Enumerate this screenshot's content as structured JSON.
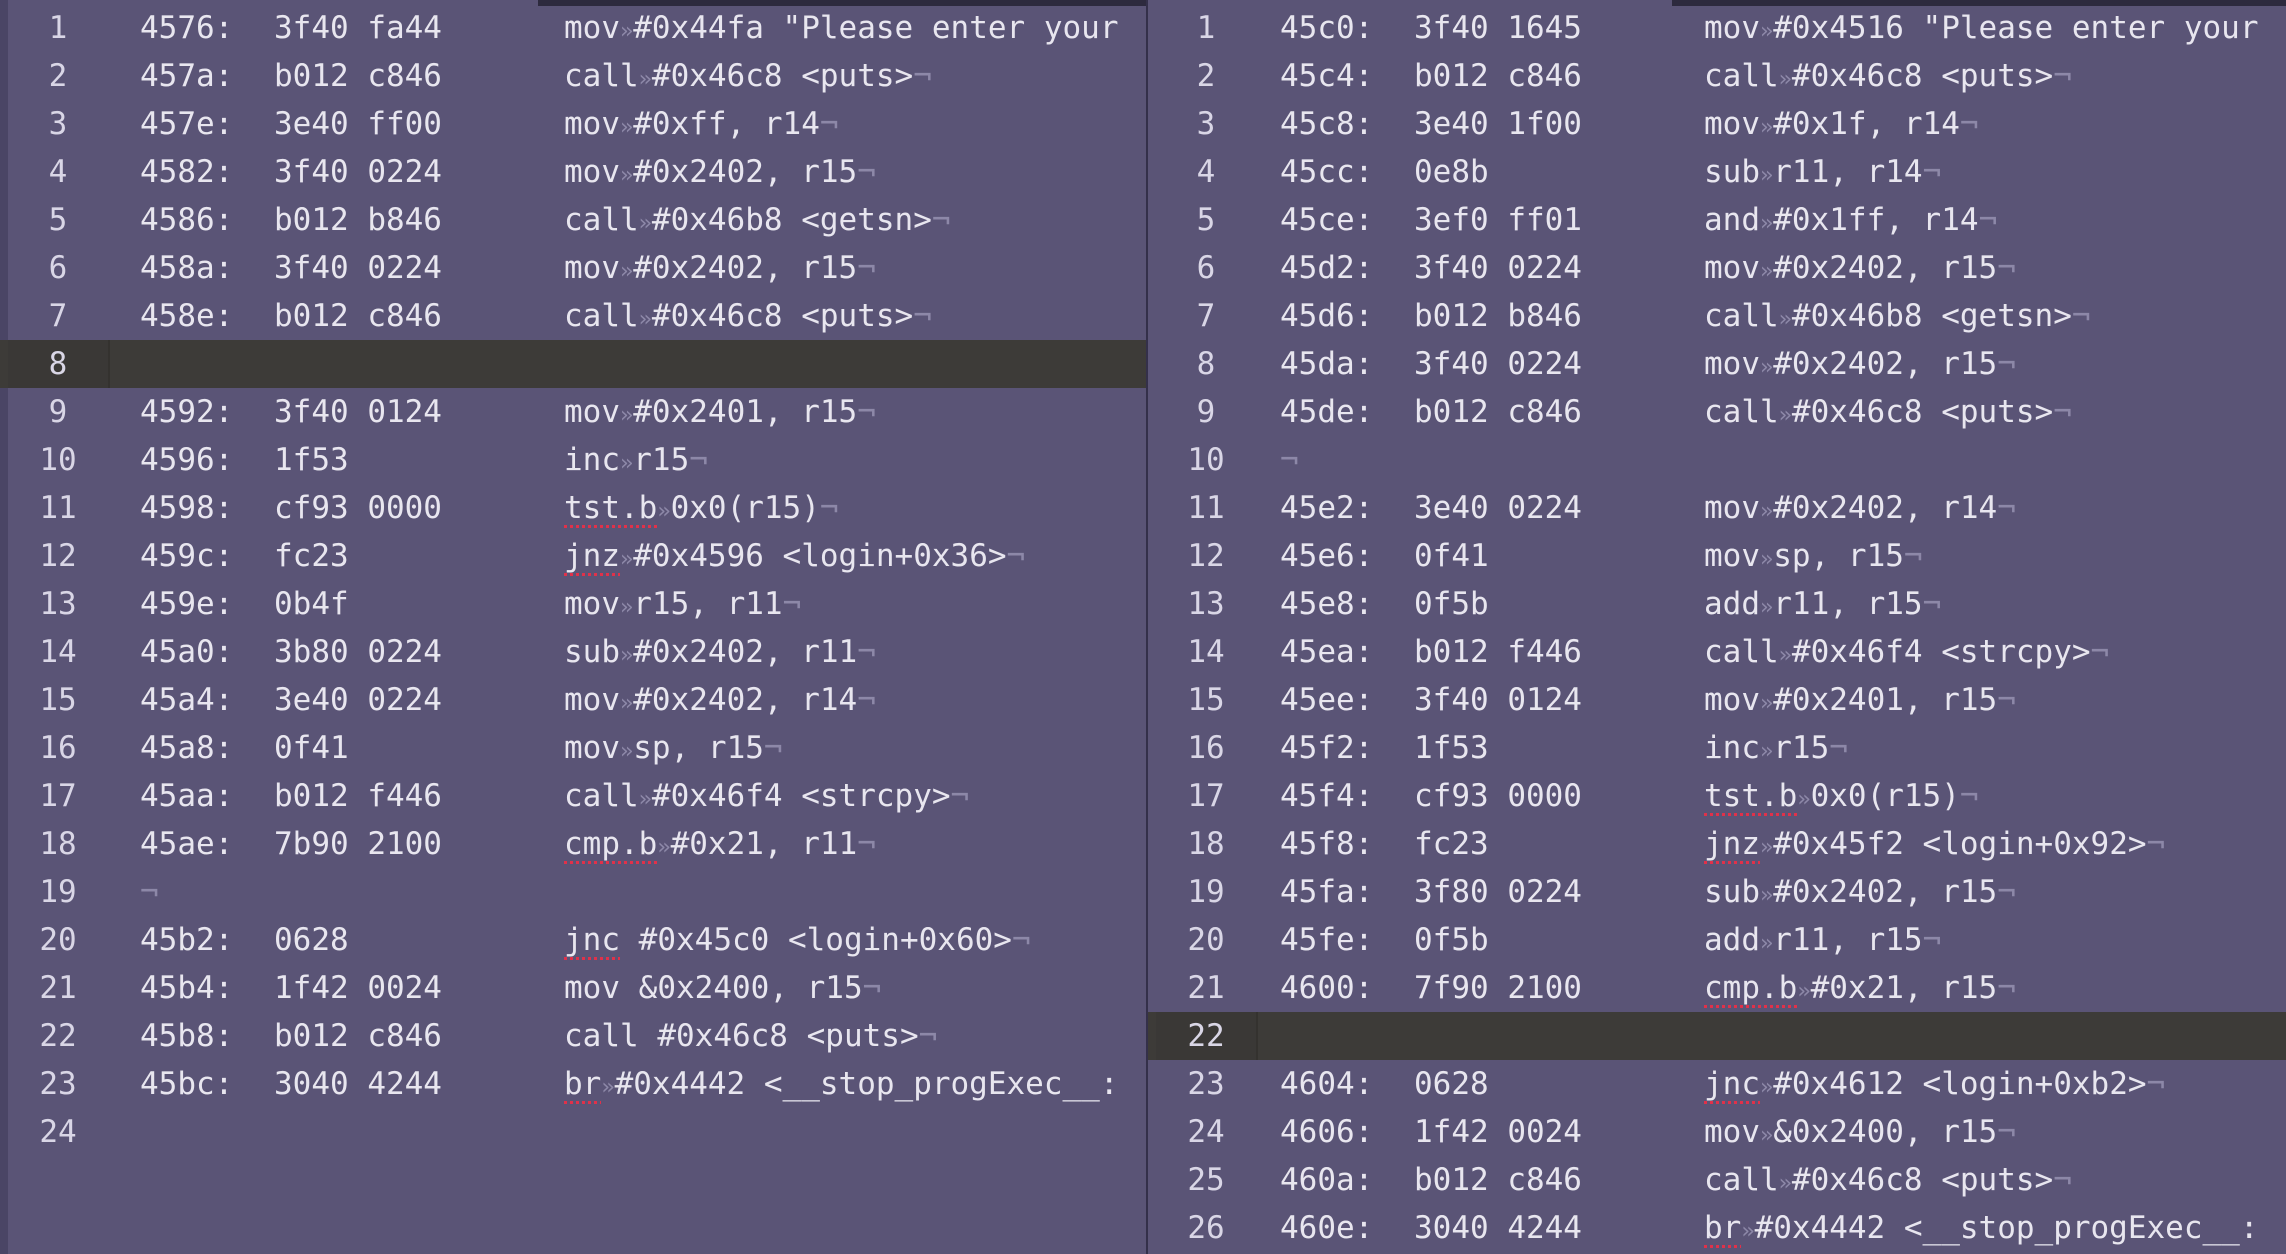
{
  "colors": {
    "background": "#5a5476",
    "current_line": "#3d3b38",
    "text": "#e8e6ef",
    "invisible_chars": "#8d88a8",
    "spell_underline": "#e0314a"
  },
  "icons": {
    "line_end": "pilcrow-icon",
    "tab_mark": "tab-arrow-icon"
  },
  "left_pane": {
    "lines": [
      {
        "num": "1",
        "addr": "4576:",
        "bytes": "3f40 fa44",
        "op": "mov",
        "sep": "tab",
        "args": "#0x44fa \"Please enter your"
      },
      {
        "num": "2",
        "addr": "457a:",
        "bytes": "b012 c846",
        "op": "call",
        "sep": "tab",
        "args": "#0x46c8 <puts>"
      },
      {
        "num": "3",
        "addr": "457e:",
        "bytes": "3e40 ff00",
        "op": "mov",
        "sep": "tab",
        "args": "#0xff, r14"
      },
      {
        "num": "4",
        "addr": "4582:",
        "bytes": "3f40 0224",
        "op": "mov",
        "sep": "tab",
        "args": "#0x2402, r15"
      },
      {
        "num": "5",
        "addr": "4586:",
        "bytes": "b012 b846",
        "op": "call",
        "sep": "tab",
        "args": "#0x46b8 <getsn>"
      },
      {
        "num": "6",
        "addr": "458a:",
        "bytes": "3f40 0224",
        "op": "mov",
        "sep": "tab",
        "args": "#0x2402, r15"
      },
      {
        "num": "7",
        "addr": "458e:",
        "bytes": "b012 c846",
        "op": "call",
        "sep": "tab",
        "args": "#0x46c8 <puts>"
      },
      {
        "num": "8",
        "addr": "",
        "bytes": "",
        "op": "",
        "sep": "",
        "args": ""
      },
      {
        "num": "9",
        "addr": "4592:",
        "bytes": "3f40 0124",
        "op": "mov",
        "sep": "tab",
        "args": "#0x2401, r15"
      },
      {
        "num": "10",
        "addr": "4596:",
        "bytes": "1f53",
        "op": "inc",
        "sep": "tab",
        "args": "r15"
      },
      {
        "num": "11",
        "addr": "4598:",
        "bytes": "cf93 0000",
        "op": "tst.b",
        "sep": "tab",
        "args": "0x0(r15)"
      },
      {
        "num": "12",
        "addr": "459c:",
        "bytes": "fc23",
        "op": "jnz",
        "sep": "tab",
        "args": "#0x4596 <login+0x36>"
      },
      {
        "num": "13",
        "addr": "459e:",
        "bytes": "0b4f",
        "op": "mov",
        "sep": "tab",
        "args": "r15, r11"
      },
      {
        "num": "14",
        "addr": "45a0:",
        "bytes": "3b80 0224",
        "op": "sub",
        "sep": "tab",
        "args": "#0x2402, r11"
      },
      {
        "num": "15",
        "addr": "45a4:",
        "bytes": "3e40 0224",
        "op": "mov",
        "sep": "tab",
        "args": "#0x2402, r14"
      },
      {
        "num": "16",
        "addr": "45a8:",
        "bytes": "0f41",
        "op": "mov",
        "sep": "tab",
        "args": "sp, r15"
      },
      {
        "num": "17",
        "addr": "45aa:",
        "bytes": "b012 f446",
        "op": "call",
        "sep": "tab",
        "args": "#0x46f4 <strcpy>"
      },
      {
        "num": "18",
        "addr": "45ae:",
        "bytes": "7b90 2100",
        "op": "cmp.b",
        "sep": "tab",
        "args": "#0x21, r11"
      },
      {
        "num": "19",
        "addr": "",
        "bytes": "",
        "op": "",
        "sep": "",
        "args": ""
      },
      {
        "num": "20",
        "addr": "45b2:",
        "bytes": "0628",
        "op": "jnc",
        "sep": "space",
        "args": "#0x45c0 <login+0x60>"
      },
      {
        "num": "21",
        "addr": "45b4:",
        "bytes": "1f42 0024",
        "op": "mov",
        "sep": "space",
        "args": "&0x2400, r15"
      },
      {
        "num": "22",
        "addr": "45b8:",
        "bytes": "b012 c846",
        "op": "call",
        "sep": "space",
        "args": "#0x46c8 <puts>"
      },
      {
        "num": "23",
        "addr": "45bc:",
        "bytes": "3040 4244",
        "op": "br",
        "sep": "tab",
        "args": "#0x4442 <__stop_progExec__:"
      },
      {
        "num": "24",
        "addr": "",
        "bytes": "",
        "op": "",
        "sep": "",
        "args": ""
      }
    ]
  },
  "right_pane": {
    "lines": [
      {
        "num": "1",
        "addr": "45c0:",
        "bytes": "3f40 1645",
        "op": "mov",
        "sep": "tab",
        "args": "#0x4516 \"Please enter your"
      },
      {
        "num": "2",
        "addr": "45c4:",
        "bytes": "b012 c846",
        "op": "call",
        "sep": "tab",
        "args": "#0x46c8 <puts>"
      },
      {
        "num": "3",
        "addr": "45c8:",
        "bytes": "3e40 1f00",
        "op": "mov",
        "sep": "tab",
        "args": "#0x1f, r14"
      },
      {
        "num": "4",
        "addr": "45cc:",
        "bytes": "0e8b",
        "op": "sub",
        "sep": "tab",
        "args": "r11, r14"
      },
      {
        "num": "5",
        "addr": "45ce:",
        "bytes": "3ef0 ff01",
        "op": "and",
        "sep": "tab",
        "args": "#0x1ff, r14"
      },
      {
        "num": "6",
        "addr": "45d2:",
        "bytes": "3f40 0224",
        "op": "mov",
        "sep": "tab",
        "args": "#0x2402, r15"
      },
      {
        "num": "7",
        "addr": "45d6:",
        "bytes": "b012 b846",
        "op": "call",
        "sep": "tab",
        "args": "#0x46b8 <getsn>"
      },
      {
        "num": "8",
        "addr": "45da:",
        "bytes": "3f40 0224",
        "op": "mov",
        "sep": "tab",
        "args": "#0x2402, r15"
      },
      {
        "num": "9",
        "addr": "45de:",
        "bytes": "b012 c846",
        "op": "call",
        "sep": "tab",
        "args": "#0x46c8 <puts>"
      },
      {
        "num": "10",
        "addr": "",
        "bytes": "",
        "op": "",
        "sep": "",
        "args": ""
      },
      {
        "num": "11",
        "addr": "45e2:",
        "bytes": "3e40 0224",
        "op": "mov",
        "sep": "tab",
        "args": "#0x2402, r14"
      },
      {
        "num": "12",
        "addr": "45e6:",
        "bytes": "0f41",
        "op": "mov",
        "sep": "tab",
        "args": "sp, r15"
      },
      {
        "num": "13",
        "addr": "45e8:",
        "bytes": "0f5b",
        "op": "add",
        "sep": "tab",
        "args": "r11, r15"
      },
      {
        "num": "14",
        "addr": "45ea:",
        "bytes": "b012 f446",
        "op": "call",
        "sep": "tab",
        "args": "#0x46f4 <strcpy>"
      },
      {
        "num": "15",
        "addr": "45ee:",
        "bytes": "3f40 0124",
        "op": "mov",
        "sep": "tab",
        "args": "#0x2401, r15"
      },
      {
        "num": "16",
        "addr": "45f2:",
        "bytes": "1f53",
        "op": "inc",
        "sep": "tab",
        "args": "r15"
      },
      {
        "num": "17",
        "addr": "45f4:",
        "bytes": "cf93 0000",
        "op": "tst.b",
        "sep": "tab",
        "args": "0x0(r15)"
      },
      {
        "num": "18",
        "addr": "45f8:",
        "bytes": "fc23",
        "op": "jnz",
        "sep": "tab",
        "args": "#0x45f2 <login+0x92>"
      },
      {
        "num": "19",
        "addr": "45fa:",
        "bytes": "3f80 0224",
        "op": "sub",
        "sep": "tab",
        "args": "#0x2402, r15"
      },
      {
        "num": "20",
        "addr": "45fe:",
        "bytes": "0f5b",
        "op": "add",
        "sep": "tab",
        "args": "r11, r15"
      },
      {
        "num": "21",
        "addr": "4600:",
        "bytes": "7f90 2100",
        "op": "cmp.b",
        "sep": "tab",
        "args": "#0x21, r15"
      },
      {
        "num": "22",
        "addr": "",
        "bytes": "",
        "op": "",
        "sep": "",
        "args": ""
      },
      {
        "num": "23",
        "addr": "4604:",
        "bytes": "0628",
        "op": "jnc",
        "sep": "tab",
        "args": "#0x4612 <login+0xb2>"
      },
      {
        "num": "24",
        "addr": "4606:",
        "bytes": "1f42 0024",
        "op": "mov",
        "sep": "tab",
        "args": "&0x2400, r15"
      },
      {
        "num": "25",
        "addr": "460a:",
        "bytes": "b012 c846",
        "op": "call",
        "sep": "tab",
        "args": "#0x46c8 <puts>"
      },
      {
        "num": "26",
        "addr": "460e:",
        "bytes": "3040 4244",
        "op": "br",
        "sep": "tab",
        "args": "#0x4442 <__stop_progExec__:"
      }
    ]
  }
}
